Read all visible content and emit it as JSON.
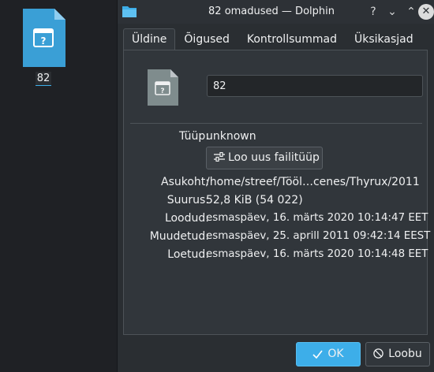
{
  "desktop": {
    "icon_name": "unknown-file-icon",
    "label": "82"
  },
  "window": {
    "title": "82 omadused — Dolphin",
    "help_glyph": "?",
    "min_glyph": "⌄",
    "max_glyph": "⌃",
    "close_glyph": "✕",
    "tabs": [
      {
        "label": "Üldine",
        "active": true
      },
      {
        "label": "Õigused"
      },
      {
        "label": "Kontrollsummad"
      },
      {
        "label": "Üksikasjad"
      }
    ]
  },
  "general": {
    "name_value": "82",
    "type_label": "Tüüp:",
    "type_value": "unknown",
    "new_type_button": "Loo uus failitüüp",
    "location_label": "Asukoht:",
    "location_value": "/home/streef/Tööl…cenes/Thyrux/2011",
    "size_label": "Suurus:",
    "size_value": "52,8 KiB (54 022)",
    "created_label": "Loodud:",
    "created_value": "esmaspäev, 16. märts 2020 10:14:47 EET",
    "modified_label": "Muudetud:",
    "modified_value": "esmaspäev, 25. aprill 2011 09:42:14 EEST",
    "accessed_label": "Loetud:",
    "accessed_value": "esmaspäev, 16. märts 2020 10:14:48 EET"
  },
  "buttons": {
    "ok": "OK",
    "cancel": "Loobu"
  },
  "colors": {
    "accent": "#3daee9",
    "window_bg": "#2a2e32",
    "panel_bg": "#31363b",
    "desktop_bg": "#1f2125"
  }
}
